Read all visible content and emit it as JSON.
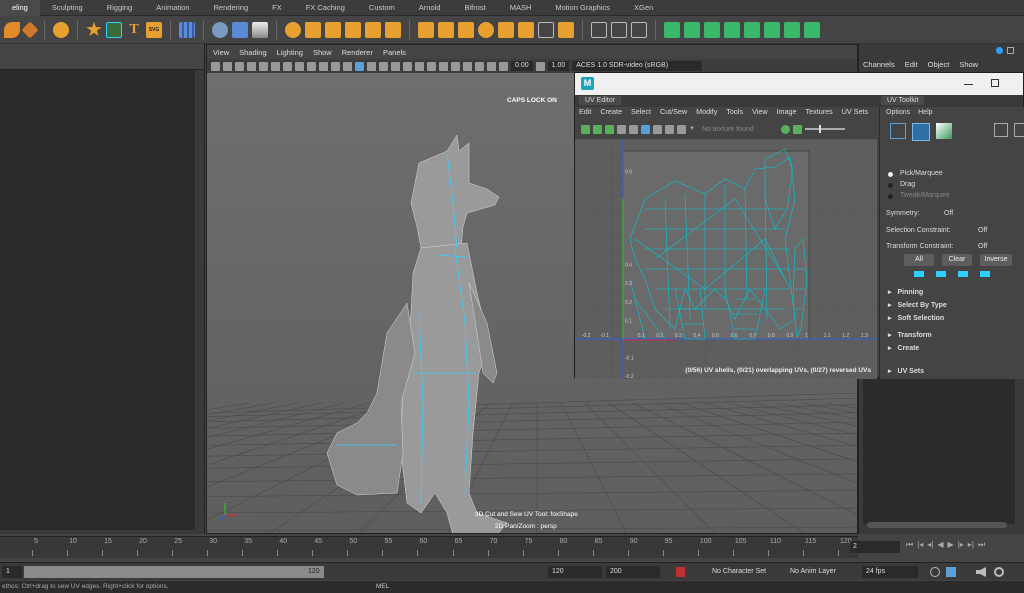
{
  "shelf_tabs": [
    "eling",
    "Sculpting",
    "Rigging",
    "Animation",
    "Rendering",
    "FX",
    "FX Caching",
    "Custom",
    "Arnold",
    "Bifrost",
    "MASH",
    "Motion Graphics",
    "XGen"
  ],
  "shelf_active": 0,
  "shelf_text": {
    "t_icon": "T",
    "svg_icon": "SVG"
  },
  "viewport": {
    "menu": [
      "View",
      "Shading",
      "Lighting",
      "Show",
      "Renderer",
      "Panels"
    ],
    "exposure": "0.00",
    "gamma": "1.00",
    "colorspace": "ACES 1.0 SDR-video (sRGB)",
    "caps_lock": "CAPS LOCK ON",
    "hud_tool": "3D Cut and Sew UV Tool: foxShape",
    "hud_camera": "2D Pan/Zoom : persp"
  },
  "channel_box": {
    "menu": [
      "Channels",
      "Edit",
      "Object",
      "Show"
    ]
  },
  "uv_editor": {
    "logo": "M",
    "tab": "UV Editor",
    "menu": [
      "Edit",
      "Create",
      "Select",
      "Cut/Sew",
      "Modify",
      "Tools",
      "View",
      "Image",
      "Textures",
      "UV Sets"
    ],
    "no_texture": "No texture found",
    "status": "(0/56) UV shells, (0/21) overlapping UVs, (0/27) reversed UVs",
    "axis_labels_x": [
      "-0.2",
      "-0.1",
      "0.1",
      "0.2",
      "0.3",
      "0.4",
      "0.5",
      "0.6",
      "0.7",
      "0.8",
      "0.9",
      "1",
      "1.1",
      "1.2",
      "1.3"
    ],
    "axis_labels_y": [
      "0.9",
      "0.4",
      "0.3",
      "0.2",
      "0.1",
      "-0.1",
      "-0.2"
    ]
  },
  "uv_toolkit": {
    "tab": "UV Toolkit",
    "menu": [
      "Options",
      "Help"
    ],
    "pick": "Pick/Marquee",
    "drag": "Drag",
    "tweak": "Tweak/Marquee",
    "symmetry_label": "Symmetry:",
    "symmetry_value": "Off",
    "sel_constraint_label": "Selection Constraint:",
    "sel_constraint_value": "Off",
    "xf_constraint_label": "Transform Constraint:",
    "xf_constraint_value": "Off",
    "btn_all": "All",
    "btn_clear": "Clear",
    "btn_inverse": "Inverse",
    "sections": [
      "Pinning",
      "Select By Type",
      "Soft Selection",
      "Transform",
      "Create",
      "UV Sets"
    ]
  },
  "timeline": {
    "ticks": [
      "5",
      "10",
      "15",
      "20",
      "25",
      "30",
      "35",
      "40",
      "45",
      "50",
      "55",
      "60",
      "65",
      "70",
      "75",
      "80",
      "85",
      "90",
      "95",
      "100",
      "105",
      "110",
      "115",
      "120"
    ],
    "current_frame": "2"
  },
  "range": {
    "start": "1",
    "range_end": "120",
    "end": "120",
    "anim_end": "200",
    "character_set": "No Character Set",
    "anim_layer": "No Anim Layer",
    "fps": "24 fps"
  },
  "command": {
    "help": "ethos: Ctrl+drag to sew UV edges. Right+click for options.",
    "mel": "MEL"
  },
  "colors": {
    "accent": "#1fb8c4",
    "uv_wire": "#00c8d8",
    "selection": "#5aa0d8"
  }
}
